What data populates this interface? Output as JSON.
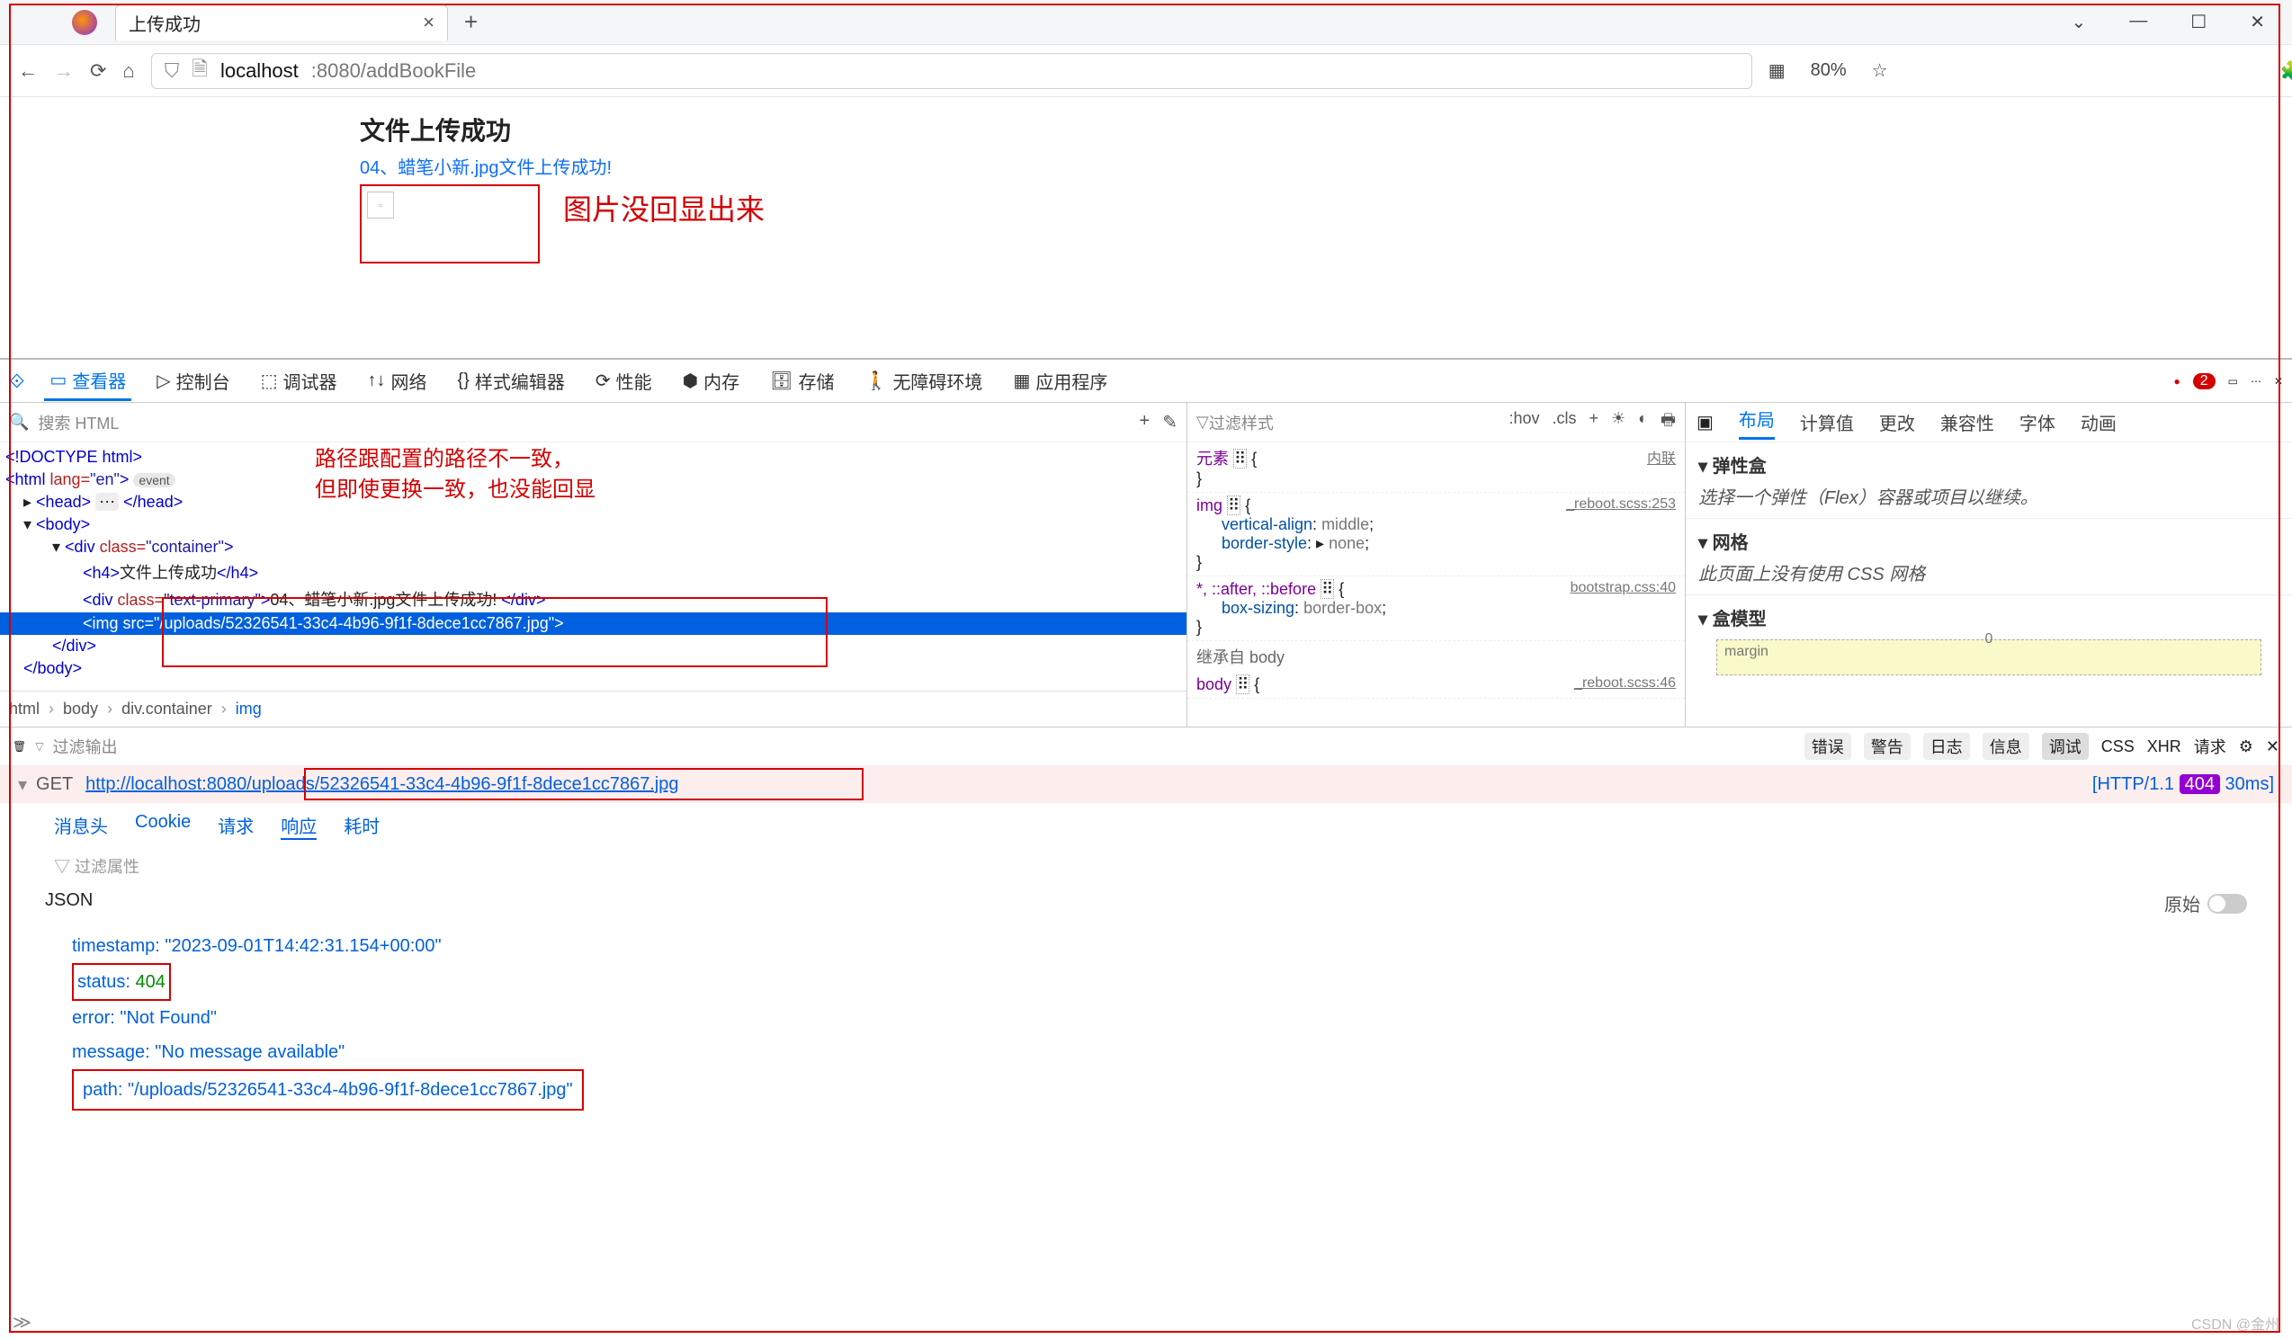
{
  "window": {
    "tab_title": "上传成功",
    "win_min": "—",
    "win_max": "☐",
    "win_close": "✕",
    "tab_chevron": "⌄"
  },
  "address": {
    "host": "localhost",
    "port_path": ":8080/addBookFile",
    "zoom": "80%"
  },
  "page": {
    "heading": "文件上传成功",
    "link_text": "04、蜡笔小新.jpg文件上传成功!",
    "annotation1": "图片没回显出来"
  },
  "devtools": {
    "tabs": {
      "inspector": "查看器",
      "console": "控制台",
      "debugger": "调试器",
      "network": "网络",
      "style": "样式编辑器",
      "perf": "性能",
      "memory": "内存",
      "storage": "存储",
      "a11y": "无障碍环境",
      "app": "应用程序"
    },
    "error_count": "2",
    "search_placeholder": "搜索 HTML",
    "annotation2_l1": "路径跟配置的路径不一致，",
    "annotation2_l2": "但即使更换一致，也没能回显",
    "dom": {
      "doctype": "<!DOCTYPE html>",
      "html_open": "<html lang=\"en\">",
      "event_pill": "event",
      "head": "<head> … </head>",
      "body_open": "<body>",
      "div_container": "<div class=\"container\">",
      "h4": "<h4>文件上传成功</h4>",
      "div_primary": "<div class=\"text-primary\">04、蜡笔小新.jpg文件上传成功! </div>",
      "img": "<img src=\"/uploads/52326541-33c4-4b96-9f1f-8dece1cc7867.jpg\">",
      "div_close": "</div>",
      "body_close": "</body>"
    },
    "crumbs": [
      "html",
      "body",
      "div.container",
      "img"
    ],
    "styles": {
      "filter": "过滤样式",
      "hov": ":hov",
      "cls": ".cls",
      "element_label": "元素",
      "inline_label": "内联",
      "img_sel": "img",
      "img_src": "_reboot.scss:253",
      "va_prop": "vertical-align",
      "va_val": "middle",
      "bs_prop": "border-style",
      "bs_val": "none",
      "star_sel": "*, ::after, ::before",
      "star_src": "bootstrap.css:40",
      "box_prop": "box-sizing",
      "box_val": "border-box",
      "inherit": "继承自 body",
      "body_sel": "body",
      "body_src": "_reboot.scss:46"
    },
    "layout": {
      "tabs": {
        "layout": "布局",
        "computed": "计算值",
        "changes": "更改",
        "compat": "兼容性",
        "fonts": "字体",
        "anim": "动画"
      },
      "flex_hd": "弹性盒",
      "flex_desc": "选择一个弹性（Flex）容器或项目以继续。",
      "grid_hd": "网格",
      "grid_desc": "此页面上没有使用 CSS 网格",
      "box_hd": "盒模型",
      "margin_label": "margin",
      "margin_val": "0"
    }
  },
  "console": {
    "trash": "🗑",
    "filter": "过滤输出",
    "cats": {
      "error": "错误",
      "warn": "警告",
      "log": "日志",
      "info": "信息",
      "debug": "调试",
      "css": "CSS",
      "xhr": "XHR",
      "req": "请求"
    }
  },
  "network": {
    "method": "GET",
    "url": "http://localhost:8080/uploads/52326541-33c4-4b96-9f1f-8dece1cc7867.jpg",
    "proto": "[HTTP/1.1",
    "status": "404",
    "time": "30ms]"
  },
  "resp_tabs": {
    "headers": "消息头",
    "cookie": "Cookie",
    "request": "请求",
    "response": "响应",
    "timings": "耗时"
  },
  "filter_attr": "过滤属性",
  "json_section": {
    "label": "JSON",
    "raw": "原始",
    "timestamp_k": "timestamp:",
    "timestamp_v": "\"2023-09-01T14:42:31.154+00:00\"",
    "status_k": "status:",
    "status_v": "404",
    "error_k": "error:",
    "error_v": "\"Not Found\"",
    "message_k": "message:",
    "message_v": "\"No message available\"",
    "path_k": "path:",
    "path_v": "\"/uploads/52326541-33c4-4b96-9f1f-8dece1cc7867.jpg\""
  },
  "footer_prompt": "≫",
  "watermark": "CSDN @金州"
}
